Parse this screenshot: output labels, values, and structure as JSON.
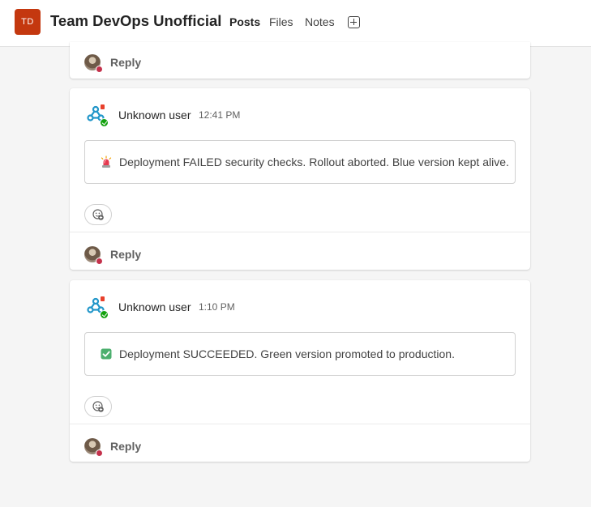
{
  "header": {
    "team_initials": "TD",
    "team_name": "Team DevOps Unofficial",
    "tabs": [
      {
        "label": "Posts",
        "active": true
      },
      {
        "label": "Files",
        "active": false
      },
      {
        "label": "Notes",
        "active": false
      }
    ],
    "accent_color": "#5b5fc7",
    "team_avatar_color": "#c4380f"
  },
  "reply_label": "Reply",
  "posts": [
    {
      "author": "Unknown user",
      "time": "12:41 PM",
      "emoji_icon": "rotating-light-icon",
      "message": "Deployment FAILED security checks. Rollout aborted. Blue version kept alive."
    },
    {
      "author": "Unknown user",
      "time": "1:10 PM",
      "emoji_icon": "check-mark-button-icon",
      "message": "Deployment SUCCEEDED. Green version promoted to production."
    }
  ]
}
